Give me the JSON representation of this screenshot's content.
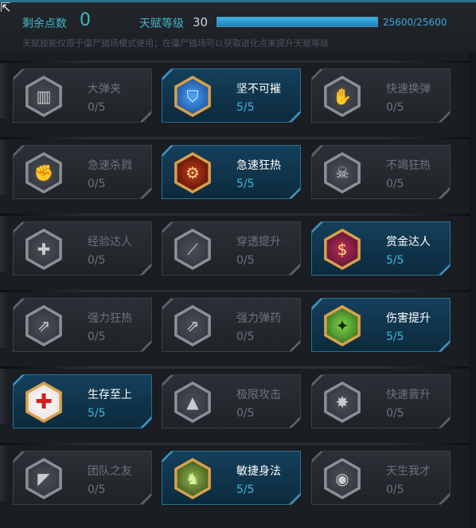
{
  "header": {
    "points_label": "剩余点数",
    "points_value": "0",
    "level_label": "天赋等级",
    "level_value": "30",
    "xp_text": "25600/25600",
    "xp_progress": 1.0,
    "info": "天赋技能仅限于僵尸猎场模式使用；在僵尸猎场可以获取进化点来提升天赋等级"
  },
  "colors": {
    "accent": "#3fb6c8",
    "active_bg": "#14405b",
    "inactive_text": "#6b737c",
    "active_level": "#3fb6e0"
  },
  "talents": [
    {
      "name": "大弹夹",
      "level": "0/5",
      "icon": "magazine-icon",
      "glyph": "▥"
    },
    {
      "name": "坚不可摧",
      "level": "5/5",
      "icon": "armor-icon",
      "glyph": "⛉"
    },
    {
      "name": "快速换弹",
      "level": "0/5",
      "icon": "reload-hand-icon",
      "glyph": "✋"
    },
    {
      "name": "急速杀戮",
      "level": "0/5",
      "icon": "fist-icon",
      "glyph": "✊"
    },
    {
      "name": "急速狂热",
      "level": "5/5",
      "icon": "rage-emblem-icon",
      "glyph": "⚙"
    },
    {
      "name": "不竭狂热",
      "level": "0/5",
      "icon": "skull-icon",
      "glyph": "☠"
    },
    {
      "name": "经验达人",
      "level": "0/5",
      "icon": "exp-plus-icon",
      "glyph": "✚"
    },
    {
      "name": "穿透提升",
      "level": "0/5",
      "icon": "penetration-icon",
      "glyph": "⟋"
    },
    {
      "name": "赏金达人",
      "level": "5/5",
      "icon": "dollar-icon",
      "glyph": "$"
    },
    {
      "name": "强力狂热",
      "level": "0/5",
      "icon": "power-rage-icon",
      "glyph": "⇗"
    },
    {
      "name": "强力弹药",
      "level": "0/5",
      "icon": "power-ammo-icon",
      "glyph": "⇗"
    },
    {
      "name": "伤害提升",
      "level": "5/5",
      "icon": "rifle-icon",
      "glyph": "✦"
    },
    {
      "name": "生存至上",
      "level": "5/5",
      "icon": "medkit-icon",
      "glyph": "✚"
    },
    {
      "name": "极限攻击",
      "level": "0/5",
      "icon": "gun-icon",
      "glyph": "▲"
    },
    {
      "name": "快速晋升",
      "level": "0/5",
      "icon": "burst-icon",
      "glyph": "✸"
    },
    {
      "name": "团队之友",
      "level": "0/5",
      "icon": "team-gun-icon",
      "glyph": "◤"
    },
    {
      "name": "敏捷身法",
      "level": "5/5",
      "icon": "soldier-icon",
      "glyph": "♞"
    },
    {
      "name": "天生我才",
      "level": "0/5",
      "icon": "eye-icon",
      "glyph": "◉"
    }
  ]
}
